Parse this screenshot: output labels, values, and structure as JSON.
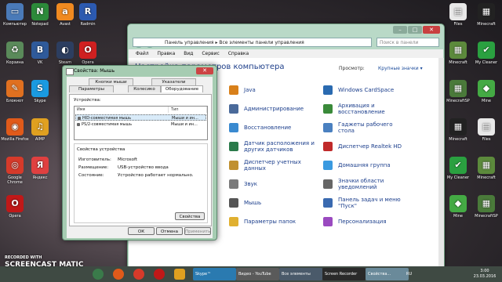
{
  "desktop_left": [
    {
      "label": "Компьютер",
      "color": "#4a7ab8",
      "glyph": "▭"
    },
    {
      "label": "Корзина",
      "color": "#5a8a5a",
      "glyph": "♻"
    },
    {
      "label": "Блокнот",
      "color": "#e07020",
      "glyph": "✎"
    },
    {
      "label": "Mozilla Firefox",
      "color": "#e05a1a",
      "glyph": "◉"
    },
    {
      "label": "Google Chrome",
      "color": "#d63a2a",
      "glyph": "◎"
    },
    {
      "label": "Opera",
      "color": "#c01818",
      "glyph": "O"
    }
  ],
  "desktop_second": [
    {
      "label": "Notepad",
      "color": "#2c8a3a",
      "glyph": "N"
    },
    {
      "label": "VK",
      "color": "#2f5a9a",
      "glyph": "В"
    },
    {
      "label": "Skype",
      "color": "#1a9ae0",
      "glyph": "S"
    },
    {
      "label": "AIMP",
      "color": "#e0a020",
      "glyph": "♫"
    },
    {
      "label": "Яндекс",
      "color": "#e04040",
      "glyph": "Я"
    }
  ],
  "desktop_third": [
    {
      "label": "Avast",
      "color": "#f08a20",
      "glyph": "a"
    },
    {
      "label": "Steam",
      "color": "#2c3e60",
      "glyph": "◐"
    }
  ],
  "desktop_fourth": [
    {
      "label": "Radmin",
      "color": "#2c5ab0",
      "glyph": "R"
    },
    {
      "label": "Opera",
      "color": "#d02020",
      "glyph": "O"
    }
  ],
  "desktop_right": [
    {
      "label": "Files",
      "color": "#e8e8e8",
      "glyph": "▤"
    },
    {
      "label": "Minecraft",
      "color": "#5c8a3c",
      "glyph": "▦"
    },
    {
      "label": "MinecraftSP",
      "color": "#4a7a3a",
      "glyph": "▦"
    },
    {
      "label": "Minecraft",
      "color": "#222",
      "glyph": "▦"
    },
    {
      "label": "My Cleaner",
      "color": "#2aa040",
      "glyph": "✔"
    },
    {
      "label": "Mine",
      "color": "#44aa44",
      "glyph": "◆"
    }
  ],
  "cp": {
    "address": "Панель управления  ▸  Все элементы панели управления",
    "search_placeholder": "Поиск в панели управления",
    "menu": [
      "Файл",
      "Правка",
      "Вид",
      "Сервис",
      "Справка"
    ],
    "heading": "Настройка параметров компьютера",
    "view_label": "Просмотр:",
    "view_value": "Крупные значки ▾",
    "col1": [
      "Java",
      "Администрирование",
      "Восстановление",
      "Датчик расположения и других датчиков",
      "Диспетчер учетных данных",
      "Звук",
      "Мышь",
      "Параметры папок"
    ],
    "col2": [
      "Windows CardSpace",
      "Архивация и восстановление",
      "Гаджеты рабочего стола",
      "Диспетчер Realtek HD",
      "Домашняя группа",
      "Значки области уведомлений",
      "Панель задач и меню \"Пуск\"",
      "Персонализация"
    ],
    "col1_colors": [
      "#d8801a",
      "#4a6a9a",
      "#3a8ad0",
      "#2a7a4a",
      "#c09030",
      "#7a7a7a",
      "#555",
      "#e0b030"
    ],
    "col2_colors": [
      "#2a6ab0",
      "#3a8a3a",
      "#4a80c0",
      "#c02a2a",
      "#3a9ae0",
      "#666",
      "#3a6ab0",
      "#9a4ac0"
    ]
  },
  "dialog": {
    "title": "Свойства: Мышь",
    "tabs_back": [
      "Кнопки мыши",
      "Указатели"
    ],
    "tabs_front": [
      "Параметры указателя",
      "Колесико",
      "Оборудование"
    ],
    "devices_label": "Устройства:",
    "col_name": "Имя",
    "col_type": "Тип",
    "devices": [
      {
        "name": "HID-совместимая мышь",
        "type": "Мыши и ин..."
      },
      {
        "name": "PS/2-совместимая мышь",
        "type": "Мыши и ин..."
      }
    ],
    "group_title": "Свойства устройства",
    "props": [
      {
        "k": "Изготовитель:",
        "v": "Microsoft"
      },
      {
        "k": "Размещение:",
        "v": "USB-устройство ввода"
      },
      {
        "k": "Состояние:",
        "v": "Устройство работает нормально."
      }
    ],
    "properties_btn": "Свойства",
    "ok": "ОК",
    "cancel": "Отмена",
    "apply": "Применить"
  },
  "taskbar": {
    "windows": [
      {
        "label": "Skype™",
        "color": "#2a7ab0"
      },
      {
        "label": "Видео - YouTube",
        "color": "#5a5a5a"
      },
      {
        "label": "Все элементы",
        "color": "#4a5a6a"
      },
      {
        "label": "Screen Recorder",
        "color": "#2a2a2a"
      },
      {
        "label": "Свойства...",
        "color": "#6a8a9a"
      }
    ],
    "lang": "RU",
    "time": "3:00",
    "date": "23.03.2016"
  },
  "watermark": {
    "line1": "RECORDED WITH",
    "line2": "SCREENCAST",
    "line3": "MATIC"
  }
}
